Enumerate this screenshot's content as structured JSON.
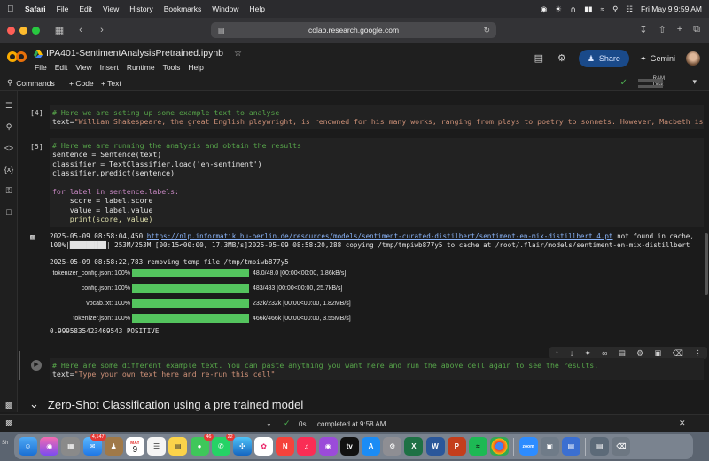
{
  "menubar": {
    "app": "Safari",
    "items": [
      "File",
      "Edit",
      "View",
      "History",
      "Bookmarks",
      "Window",
      "Help"
    ],
    "datetime": "Fri May 9  9:59 AM"
  },
  "safari": {
    "url": "colab.research.google.com"
  },
  "colab": {
    "notebook_title": "IPA401-SentimentAnalysisPretrained.ipynb",
    "menu": [
      "File",
      "Edit",
      "View",
      "Insert",
      "Runtime",
      "Tools",
      "Help"
    ],
    "share_label": "Share",
    "gemini_label": "Gemini"
  },
  "toolbar": {
    "commands_label": "Commands",
    "add_code_label": "+ Code",
    "add_text_label": "+ Text",
    "ram_label": "RAM",
    "disk_label": "Disk"
  },
  "cells": {
    "cell4": {
      "exec_count": "[4]",
      "comment": "# Here we are seting up some example text to analyse",
      "line2_var": "text=",
      "line2_str": "\"William Shakespeare, the great English playwright, is renowned for his many works, ranging from plays to poetry to sonnets. However, Macbeth is consider"
    },
    "cell5": {
      "exec_count": "[5]",
      "lines": [
        "# Here we are running the analysis and obtain the results",
        "sentence = Sentence(text)",
        "classifier = TextClassifier.load('en-sentiment')",
        "classifier.predict(sentence)",
        "",
        "for label in sentence.labels:",
        "    score = label.score",
        "    value = label.value",
        "    print(score, value)"
      ]
    },
    "output": {
      "log1_prefix": "2025-05-09 08:58:04,450 ",
      "log1_link": "https://nlp.informatik.hu-berlin.de/resources/models/sentiment-curated-distilbert/sentiment-en-mix-distillbert_4.pt",
      "log1_suffix": " not found in cache,",
      "log2": "100%|█████████| 253M/253M [00:15<00:00, 17.3MB/s]2025-05-09 08:58:20,288 copying /tmp/tmpiwb877y5 to cache at /root/.flair/models/sentiment-en-mix-distillbert",
      "log3": "2025-05-09 08:58:22,783 removing temp file /tmp/tmpiwb877y5",
      "downloads": [
        {
          "label": "tokenizer_config.json: 100%",
          "stat": "48.0/48.0 [00:00<00:00, 1.86kB/s]",
          "progress": 1.0
        },
        {
          "label": "config.json: 100%",
          "stat": "483/483 [00:00<00:00, 25.7kB/s]",
          "progress": 1.0
        },
        {
          "label": "vocab.txt: 100%",
          "stat": "232k/232k [00:00<00:00, 1.82MB/s]",
          "progress": 1.0
        },
        {
          "label": "tokenizer.json: 100%",
          "stat": "466k/466k [00:00<00:00, 3.55MB/s]",
          "progress": 1.0
        }
      ],
      "result": "0.9995835423469543 POSITIVE"
    },
    "cell6": {
      "comment": "# Here are some different example text. You can paste anything you want here and run the above cell again to see the results.",
      "line2_var": "text=",
      "line2_str": "\"Type your own text here and re-run this cell\""
    }
  },
  "section": {
    "title": "Zero-Shot Classification using a pre trained model"
  },
  "status": {
    "elapsed": "0s",
    "completed": "completed at 9:58 AM"
  },
  "dock": {
    "mail_badge": "4,147",
    "calendar_month": "MAY",
    "calendar_day": "9",
    "messages_badge": "46",
    "whatsapp_badge": "22",
    "shortcut_label": "Sh"
  },
  "colors": {
    "accent_green": "#54c45e",
    "link": "#8ab4f8",
    "comment": "#57a64a",
    "string": "#ce9178"
  }
}
